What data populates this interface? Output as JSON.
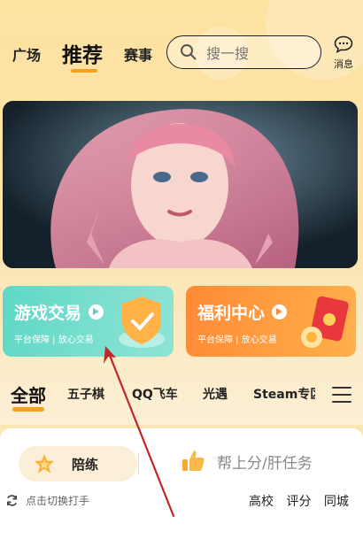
{
  "header": {
    "tabs": [
      {
        "label": "广场"
      },
      {
        "label": "推荐"
      },
      {
        "label": "赛事"
      }
    ],
    "search_placeholder": "搜一搜",
    "message_label": "消息"
  },
  "cards": {
    "game_trade": {
      "title": "游戏交易",
      "subtitle": "平台保障 | 放心交易"
    },
    "welfare": {
      "title": "福利中心",
      "subtitle": "平台保障 | 放心交易"
    }
  },
  "categories": [
    "全部",
    "五子棋",
    "QQ飞车",
    "光遇",
    "Steam专区"
  ],
  "panel": {
    "peilian_label": "陪练",
    "help_label": "帮上分/肝任务",
    "switch_label": "点击切换打手",
    "filters": [
      "高校",
      "评分",
      "同城"
    ]
  },
  "colors": {
    "accent": "#f4a21d",
    "game_card": "#5fd8c6",
    "welfare_card": "#ff8a36",
    "annotation_arrow": "#c0262b"
  }
}
